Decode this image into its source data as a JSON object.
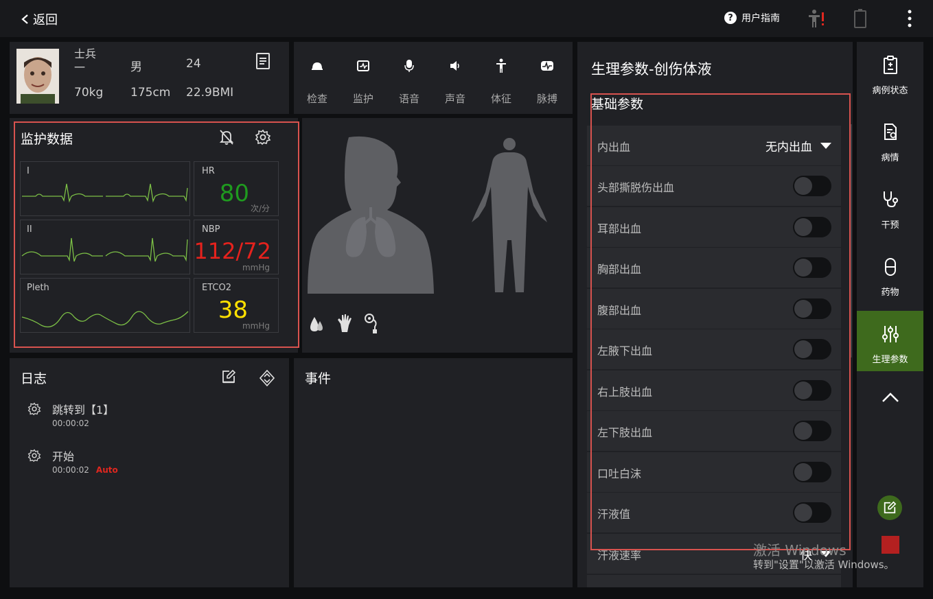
{
  "topbar": {
    "back_label": "返回",
    "guide_label": "用户指南"
  },
  "patient": {
    "name": "士兵一",
    "gender": "男",
    "age": "24",
    "weight": "70kg",
    "height": "175cm",
    "bmi": "22.9BMI"
  },
  "tools": [
    {
      "label": "检查",
      "icon": "exam-icon"
    },
    {
      "label": "监护",
      "icon": "monitor-icon"
    },
    {
      "label": "语音",
      "icon": "microphone-icon"
    },
    {
      "label": "声音",
      "icon": "speaker-icon"
    },
    {
      "label": "体征",
      "icon": "body-sign-icon"
    },
    {
      "label": "脉搏",
      "icon": "pulse-icon"
    }
  ],
  "monitor": {
    "title": "监护数据",
    "waves": [
      "I",
      "II",
      "Pleth"
    ],
    "vitals": [
      {
        "label": "HR",
        "value": "80",
        "unit": "次/分",
        "color": "#1f9a1f"
      },
      {
        "label": "NBP",
        "value": "112/72",
        "unit": "mmHg",
        "color": "#e5221d"
      },
      {
        "label": "ETCO2",
        "value": "38",
        "unit": "mmHg",
        "color": "#ffe000"
      }
    ]
  },
  "log": {
    "title": "日志",
    "items": [
      {
        "text": "跳转到【1】",
        "time": "00:00:02",
        "tag": ""
      },
      {
        "text": "开始",
        "time": "00:00:02",
        "tag": "Auto"
      }
    ]
  },
  "events": {
    "title": "事件"
  },
  "params": {
    "title": "生理参数-创伤体液",
    "section": "基础参数",
    "rows": [
      {
        "name": "内出血",
        "type": "dropdown",
        "value": "无内出血"
      },
      {
        "name": "头部撕脱伤出血",
        "type": "toggle",
        "on": false
      },
      {
        "name": "耳部出血",
        "type": "toggle",
        "on": false
      },
      {
        "name": "胸部出血",
        "type": "toggle",
        "on": false
      },
      {
        "name": "腹部出血",
        "type": "toggle",
        "on": false
      },
      {
        "name": "左腋下出血",
        "type": "toggle",
        "on": false
      },
      {
        "name": "右上肢出血",
        "type": "toggle",
        "on": false
      },
      {
        "name": "左下肢出血",
        "type": "toggle",
        "on": false
      },
      {
        "name": "口吐白沫",
        "type": "toggle",
        "on": false
      },
      {
        "name": "汗液值",
        "type": "toggle",
        "on": false
      },
      {
        "name": "汗液速率",
        "type": "dropdown",
        "value": "快"
      }
    ]
  },
  "sidebar": {
    "items": [
      {
        "label": "病例状态",
        "icon": "clipboard-icon"
      },
      {
        "label": "病情",
        "icon": "record-icon"
      },
      {
        "label": "干预",
        "icon": "stethoscope-icon"
      },
      {
        "label": "药物",
        "icon": "capsule-icon"
      },
      {
        "label": "生理参数",
        "icon": "sliders-icon",
        "active": true
      }
    ],
    "accent": "#3e6a1d"
  },
  "watermark": {
    "line1": "激活 Windows",
    "line2": "转到\"设置\"以激活 Windows。"
  }
}
